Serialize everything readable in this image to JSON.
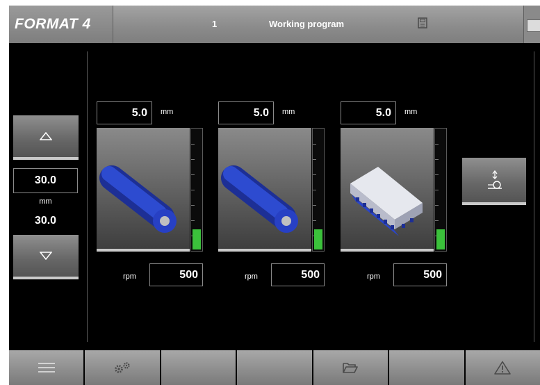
{
  "header": {
    "logo": "FORMAT 4",
    "program_number": "1",
    "program_title": "Working program",
    "save_icon": "save-icon"
  },
  "axis": {
    "up_icon": "triangle-up-icon",
    "down_icon": "triangle-down-icon",
    "value": "30.0",
    "unit": "mm",
    "actual_value": "30.0"
  },
  "units": [
    {
      "name": "unit-1",
      "mm_value": "5.0",
      "mm_label": "mm",
      "rpm_label": "rpm",
      "rpm_value": "500",
      "tool": "cylindrical-roller",
      "tool_color": "#2a45c8",
      "gauge_level": 0.17
    },
    {
      "name": "unit-2",
      "mm_value": "5.0",
      "mm_label": "mm",
      "rpm_label": "rpm",
      "rpm_value": "500",
      "tool": "cylindrical-roller",
      "tool_color": "#2a45c8",
      "gauge_level": 0.17
    },
    {
      "name": "unit-3",
      "mm_value": "5.0",
      "mm_label": "mm",
      "rpm_label": "rpm",
      "rpm_value": "500",
      "tool": "pad",
      "tool_color": "#c8ccd8",
      "gauge_level": 0.17
    }
  ],
  "mode_button_icon": "roller-settings-icon",
  "bottom_bar": [
    {
      "name": "menu",
      "icon": "menu-lines-icon"
    },
    {
      "name": "units",
      "icon": "gears-icon"
    },
    {
      "name": "empty-1",
      "icon": ""
    },
    {
      "name": "empty-2",
      "icon": ""
    },
    {
      "name": "open",
      "icon": "folder-open-icon"
    },
    {
      "name": "empty-3",
      "icon": ""
    },
    {
      "name": "alarms",
      "icon": "warning-triangle-icon"
    }
  ],
  "colors": {
    "background": "#000000",
    "bar": "#9a9a9a",
    "gauge_fill": "#3bc13b",
    "roller_blue": "#2a45c8"
  }
}
